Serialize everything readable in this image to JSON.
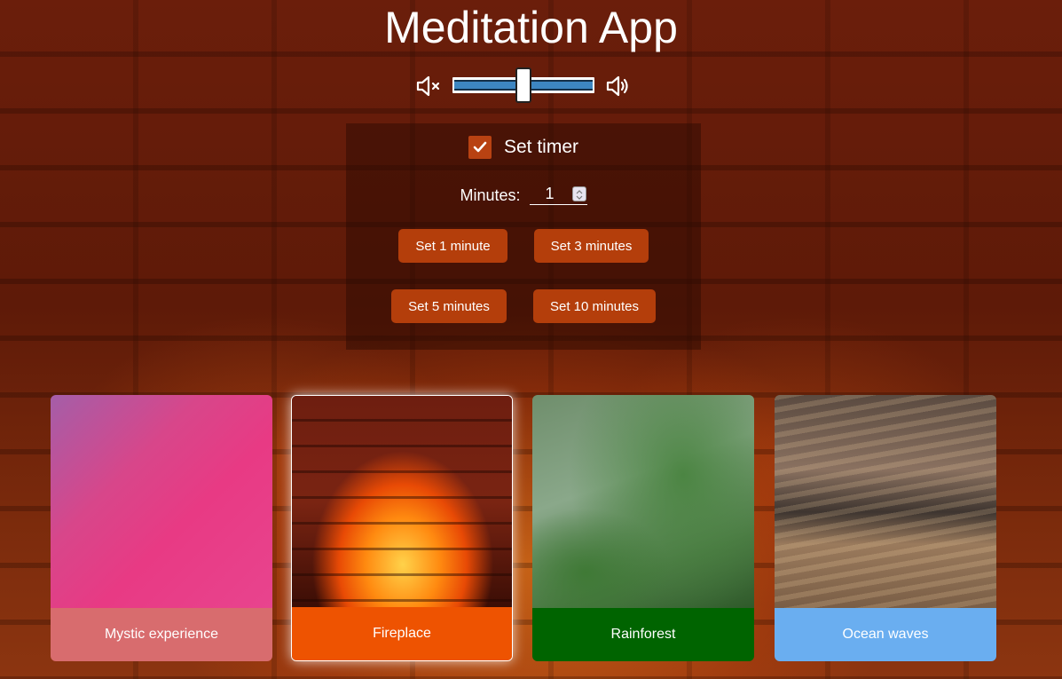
{
  "app": {
    "title": "Meditation App"
  },
  "volume": {
    "mute_icon": "volume-mute-icon",
    "loud_icon": "volume-up-icon",
    "level_fraction": 0.5
  },
  "timer": {
    "enabled": true,
    "checkbox_icon": "check-icon",
    "set_timer_label": "Set timer",
    "minutes_label": "Minutes:",
    "minutes_value": "1",
    "presets": [
      {
        "label": "Set 1 minute"
      },
      {
        "label": "Set 3 minutes"
      },
      {
        "label": "Set 5 minutes"
      },
      {
        "label": "Set 10 minutes"
      }
    ]
  },
  "scenes": [
    {
      "label": "Mystic experience",
      "caption_color": "#d86c6e",
      "selected": false
    },
    {
      "label": "Fireplace",
      "caption_color": "#ee5301",
      "selected": true
    },
    {
      "label": "Rainforest",
      "caption_color": "#006400",
      "selected": false
    },
    {
      "label": "Ocean waves",
      "caption_color": "#6aaef0",
      "selected": false
    }
  ],
  "colors": {
    "accent": "#b43e0b",
    "checkbox": "#b84212"
  }
}
